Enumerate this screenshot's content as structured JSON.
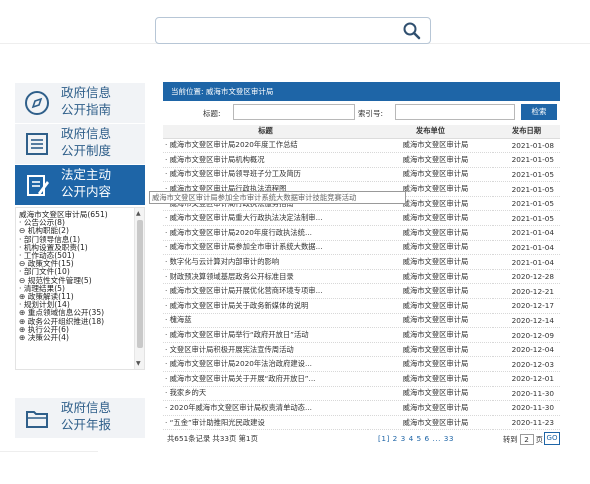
{
  "search": {
    "placeholder": ""
  },
  "nav": {
    "guide": {
      "line1": "政府信息",
      "line2": "公开指南"
    },
    "system": {
      "line1": "政府信息",
      "line2": "公开制度"
    },
    "statutory": {
      "line1": "法定主动",
      "line2": "公开内容"
    },
    "annual": {
      "line1": "政府信息",
      "line2": "公开年报"
    }
  },
  "tree": {
    "items": [
      "威海市文登区审计局(651)",
      "· 公告公示(8)",
      "⊖ 机构职能(2)",
      "   · 部门领导信息(1)",
      "   · 机构设置及职责(1)",
      "· 工作动态(501)",
      "⊖ 政策文件(15)",
      "   · 部门文件(10)",
      "   ⊖ 规范性文件管理(5)",
      "      · 清理结果(5)",
      "⊕ 政策解读(11)",
      "· 规划计划(14)",
      "⊕ 重点领域信息公开(35)",
      "⊕ 政务公开组织推进(18)",
      "⊕ 执行公开(6)",
      "⊕ 决策公开(4)"
    ]
  },
  "main": {
    "location": "当前位置: 威海市文登区审计局",
    "title_label": "标题:",
    "index_label": "索引号:",
    "search_button": "检索",
    "columns": [
      "标题",
      "发布单位",
      "发布日期"
    ],
    "rows": [
      {
        "title": "· 威海市文登区审计局2020年度工作总结",
        "unit": "威海市文登区审计局",
        "date": "2021-01-08"
      },
      {
        "title": "· 威海市文登区审计局机构概况",
        "unit": "威海市文登区审计局",
        "date": "2021-01-05"
      },
      {
        "title": "· 威海市文登区审计局领导班子分工及简历",
        "unit": "威海市文登区审计局",
        "date": "2021-01-05"
      },
      {
        "title": "· 威海市文登区审计局行政执法流程图",
        "unit": "威海市文登区审计局",
        "date": "2021-01-05"
      },
      {
        "title": "· 威海市文登区审计局行政执法服务指南",
        "unit": "威海市文登区审计局",
        "date": "2021-01-05"
      },
      {
        "title": "· 威海市文登区审计局重大行政执法决定法制审...",
        "unit": "威海市文登区审计局",
        "date": "2021-01-05"
      },
      {
        "title": "· 威海市文登区审计局2020年度行政执法统...",
        "unit": "威海市文登区审计局",
        "date": "2021-01-04"
      },
      {
        "title": "· 威海市文登区审计局参加全市审计系统大数据...",
        "unit": "威海市文登区审计局",
        "date": "2021-01-04"
      },
      {
        "title": "· 数字化与云计算对内部审计的影响",
        "unit": "威海市文登区审计局",
        "date": "2021-01-04"
      },
      {
        "title": "· 财政预决算领域基层政务公开标准目录",
        "unit": "威海市文登区审计局",
        "date": "2020-12-28"
      },
      {
        "title": "· 威海市文登区审计局开展优化营商环境专项审...",
        "unit": "威海市文登区审计局",
        "date": "2020-12-21"
      },
      {
        "title": "· 威海市文登区审计局关于政务新媒体的说明",
        "unit": "威海市文登区审计局",
        "date": "2020-12-17"
      },
      {
        "title": "· 槐海蓝",
        "unit": "威海市文登区审计局",
        "date": "2020-12-14"
      },
      {
        "title": "· 威海市文登区审计局举行“政府开放日”活动",
        "unit": "威海市文登区审计局",
        "date": "2020-12-09"
      },
      {
        "title": "· 文登区审计局积极开展宪法宣传周活动",
        "unit": "威海市文登区审计局",
        "date": "2020-12-04"
      },
      {
        "title": "· 威海市文登区审计局2020年法治政府建设...",
        "unit": "威海市文登区审计局",
        "date": "2020-12-03"
      },
      {
        "title": "· 威海市文登区审计局关于开展“政府开放日”...",
        "unit": "威海市文登区审计局",
        "date": "2020-12-01"
      },
      {
        "title": "· 我家乡的天",
        "unit": "威海市文登区审计局",
        "date": "2020-11-30"
      },
      {
        "title": "· 2020年威海市文登区审计局权责清单动态...",
        "unit": "威海市文登区审计局",
        "date": "2020-11-30"
      },
      {
        "title": "· “五金”审计助推阳光民政建设",
        "unit": "威海市文登区审计局",
        "date": "2020-11-23"
      }
    ],
    "tooltip": "威海市文登区审计局参加全市审计系统大数据审计技能竞赛活动",
    "pager": {
      "summary": "共651条记录 共33页 第1页",
      "pages": "[1] 2 3 4 5 6 ... 33",
      "goto_prefix": "转到",
      "goto_value": "2",
      "goto_suffix": "页",
      "go": "GO"
    }
  }
}
